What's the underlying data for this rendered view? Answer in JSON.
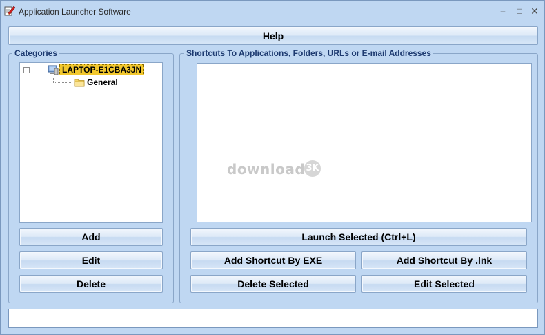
{
  "window": {
    "title": "Application Launcher Software",
    "controls": {
      "minimize": "–",
      "maximize": "□",
      "close": "✕"
    },
    "icon": "app-launcher-icon"
  },
  "toolbar": {
    "help_label": "Help"
  },
  "categories": {
    "legend": "Categories",
    "tree": {
      "root": {
        "label": "LAPTOP-E1CBA3JN",
        "icon": "computer-icon",
        "expander": "⊟"
      },
      "children": [
        {
          "label": "General",
          "icon": "folder-icon"
        }
      ]
    },
    "buttons": {
      "add": "Add",
      "edit": "Edit",
      "delete": "Delete"
    }
  },
  "shortcuts": {
    "legend": "Shortcuts To Applications, Folders, URLs or E-mail Addresses",
    "items": [],
    "watermark": {
      "text": "download",
      "badge": "3K"
    },
    "buttons": {
      "launch": "Launch Selected (Ctrl+L)",
      "add_exe": "Add Shortcut By EXE",
      "add_lnk": "Add Shortcut By .lnk",
      "delete": "Delete Selected",
      "edit": "Edit Selected"
    }
  },
  "status": {
    "text": ""
  },
  "colors": {
    "window_bg": "#bfd7f2",
    "border": "#8aa6c8",
    "legend_text": "#1d3a70",
    "selection": "#f2c82e"
  }
}
